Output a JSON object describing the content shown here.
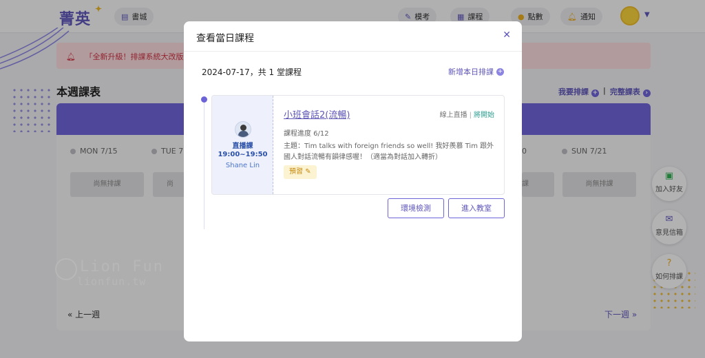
{
  "brand": {
    "logo_text": "菁英"
  },
  "nav": {
    "bookstore": "書城",
    "mock_exam": "模考",
    "courses": "課程",
    "points": "點數",
    "notifications": "通知"
  },
  "notice": {
    "text": "「全新升級！排課系統大改版"
  },
  "week": {
    "title": "本週課表",
    "my_booking": "我要排課",
    "full_schedule": "完整課表",
    "days": [
      "MON 7/15",
      "TUE 7",
      "0",
      "SUN 7/21"
    ],
    "no_class": "尚無排課",
    "no_class_partial": "尚",
    "no_class_partial2": "課",
    "prev": "« 上一週",
    "next": "下一週 »"
  },
  "side": {
    "add_friend": "加入好友",
    "feedback": "意見信箱",
    "how_to": "如何排課"
  },
  "watermark": {
    "big": "Lion Fun",
    "small": "lionfun.tw"
  },
  "modal": {
    "title": "查看當日課程",
    "date_summary": "2024-07-17，共 1 堂課程",
    "add_daily": "新增本日排課",
    "lesson": {
      "type": "直播課",
      "time": "19:00~19:50",
      "teacher": "Shane Lin",
      "name": "小班會話2(流暢)",
      "mode": "線上直播",
      "status": "將開始",
      "progress": "課程進度 6/12",
      "topic": "主題：Tim talks with foreign friends so well! 我好羨慕 Tim 跟外國人對話流暢有韻律感喔！（適當為對話加入轉折）",
      "preview": "預習"
    },
    "env_check": "環境檢測",
    "enter_class": "進入教室"
  },
  "colors": {
    "brand": "#5e55b8",
    "accent": "#6c63d6",
    "status": "#2a9d8f",
    "warning": "#c68a10"
  }
}
